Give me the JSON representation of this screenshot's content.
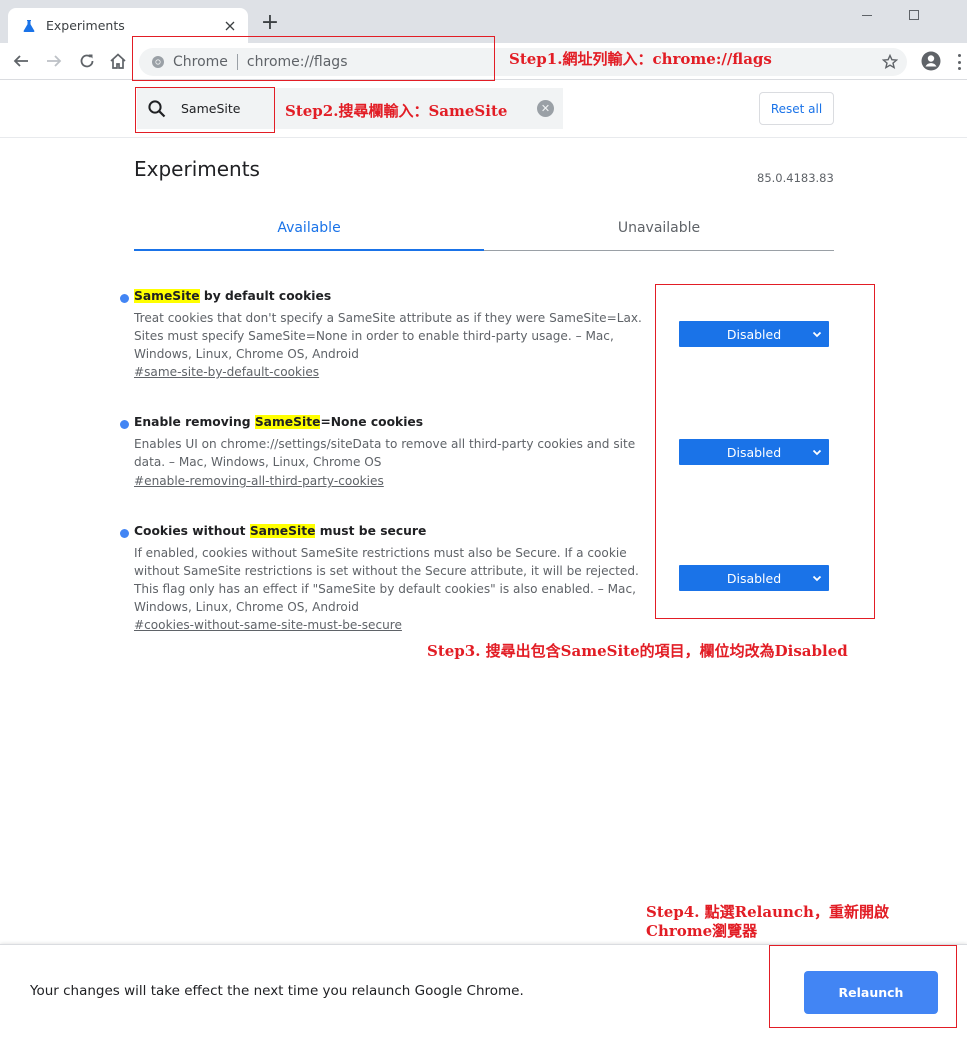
{
  "window": {
    "tab_title": "Experiments",
    "tab_icon": "flask-icon",
    "new_tab_symbol": "+",
    "controls": [
      "minimize-icon",
      "maximize-icon"
    ]
  },
  "toolbar": {
    "site_chip": "Chrome",
    "url": "chrome://flags"
  },
  "search": {
    "value": "SameSite",
    "clear_symbol": "✕"
  },
  "header": {
    "reset_label": "Reset all"
  },
  "page": {
    "title": "Experiments",
    "version": "85.0.4183.83",
    "tabs": [
      {
        "label": "Available",
        "active": true
      },
      {
        "label": "Unavailable",
        "active": false
      }
    ]
  },
  "experiments": [
    {
      "title_pre": "",
      "title_hl": "SameSite",
      "title_post": " by default cookies",
      "description": "Treat cookies that don't specify a SameSite attribute as if they were SameSite=Lax. Sites must specify SameSite=None in order to enable third-party usage. – Mac, Windows, Linux, Chrome OS, Android",
      "link": "#same-site-by-default-cookies",
      "value": "Disabled"
    },
    {
      "title_pre": "Enable removing ",
      "title_hl": "SameSite",
      "title_post": "=None cookies",
      "description": "Enables UI on chrome://settings/siteData to remove all third-party cookies and site data. – Mac, Windows, Linux, Chrome OS",
      "link": "#enable-removing-all-third-party-cookies",
      "value": "Disabled"
    },
    {
      "title_pre": "Cookies without ",
      "title_hl": "SameSite",
      "title_post": " must be secure",
      "description": "If enabled, cookies without SameSite restrictions must also be Secure. If a cookie without SameSite restrictions is set without the Secure attribute, it will be rejected. This flag only has an effect if \"SameSite by default cookies\" is also enabled. – Mac, Windows, Linux, Chrome OS, Android",
      "link": "#cookies-without-same-site-must-be-secure",
      "value": "Disabled"
    }
  ],
  "annotations": {
    "step1": "Step1.網址列輸入：chrome://flags",
    "step2": "Step2.搜尋欄輸入：SameSite",
    "step3": "Step3. 搜尋出包含SameSite的項目，欄位均改為Disabled",
    "step4_line1": "Step4. 點選Relaunch，重新開啟",
    "step4_line2": "Chrome瀏覽器",
    "color": "#e21d25"
  },
  "relaunch": {
    "message": "Your changes will take effect the next time you relaunch Google Chrome.",
    "button_label": "Relaunch"
  },
  "colors": {
    "accent": "#1a73e8",
    "select_bg": "#1a73e8",
    "relaunch_bg": "#4285f4",
    "highlight": "#ffff00",
    "tabstrip": "#dee1e6"
  }
}
